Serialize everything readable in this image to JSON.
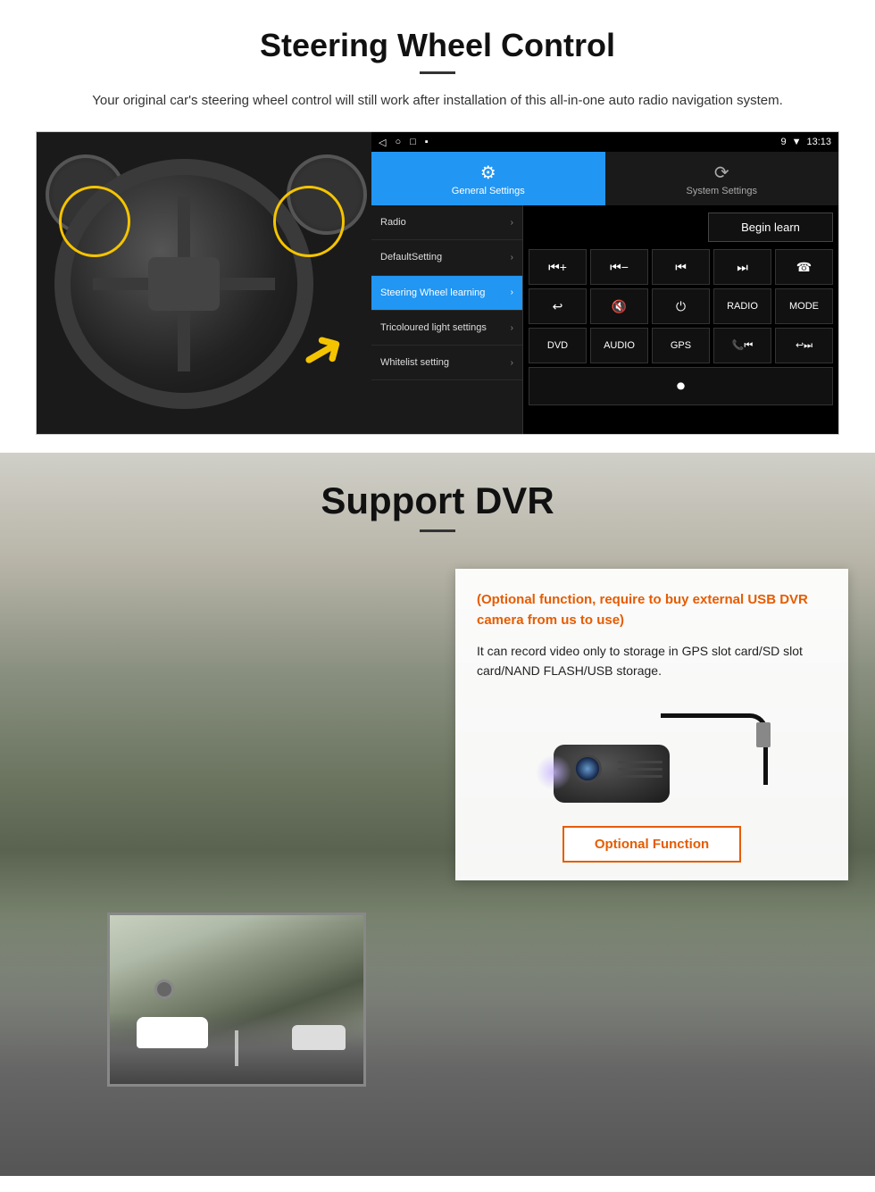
{
  "steering": {
    "title": "Steering Wheel Control",
    "subtitle": "Your original car's steering wheel control will still work after installation of this all-in-one auto radio navigation system.",
    "statusbar": {
      "left": [
        "◁",
        "○",
        "□",
        "▪"
      ],
      "right": [
        "9",
        "▼",
        "13:13"
      ]
    },
    "tabs": [
      {
        "icon": "⚙",
        "label": "General Settings",
        "active": true
      },
      {
        "icon": "⟳",
        "label": "System Settings",
        "active": false
      }
    ],
    "menu_items": [
      {
        "label": "Radio",
        "active": false
      },
      {
        "label": "DefaultSetting",
        "active": false
      },
      {
        "label": "Steering Wheel learning",
        "active": true
      },
      {
        "label": "Tricoloured light settings",
        "active": false
      },
      {
        "label": "Whitelist setting",
        "active": false
      }
    ],
    "begin_learn": "Begin learn",
    "control_buttons": [
      [
        "⏮+",
        "⏮−",
        "⏮⏮",
        "⏭⏭",
        "☎"
      ],
      [
        "↩",
        "🔇x",
        "⏻",
        "RADIO",
        "MODE"
      ],
      [
        "DVD",
        "AUDIO",
        "GPS",
        "📞⏮",
        "↩⏭"
      ],
      [
        "⏺"
      ]
    ]
  },
  "dvr": {
    "title": "Support DVR",
    "optional_text": "(Optional function, require to buy external USB DVR camera from us to use)",
    "body_text": "It can record video only to storage in GPS slot card/SD slot card/NAND FLASH/USB storage.",
    "optional_fn_button": "Optional Function"
  }
}
